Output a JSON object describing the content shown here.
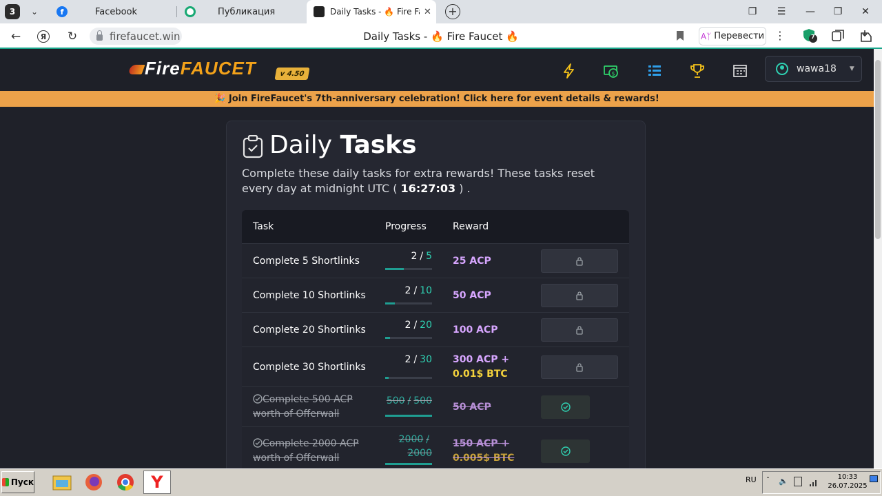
{
  "browser": {
    "tab_count": "3",
    "tabs": [
      {
        "title": "Facebook",
        "icon": "facebook-icon",
        "color": "#1877f2"
      },
      {
        "title": "Публикация",
        "icon": "publication-icon",
        "color": "#19a974"
      },
      {
        "title": "Daily Tasks - 🔥 Fire Fau",
        "icon": "firefaucet-icon",
        "color": "#222"
      }
    ],
    "url": "firefaucet.win",
    "page_title": "Daily Tasks - 🔥 Fire Faucet 🔥",
    "translate_label": "Перевести",
    "shield_badge": "7"
  },
  "site": {
    "logo_fire": "Fire",
    "logo_faucet": "FAUCET",
    "version": "v 4.50",
    "username": "wawa18",
    "nav_icons": [
      "bolt-icon",
      "money-icon",
      "tasks-icon",
      "trophy-icon",
      "calendar-icon"
    ],
    "accent": "#2fd1b2",
    "banner": "🎉 Join FireFaucet's 7th-anniversary celebration! Click here for event details & rewards!"
  },
  "page": {
    "title_light": "Daily",
    "title_bold": "Tasks",
    "subtitle": "Complete these daily tasks for extra rewards! These tasks reset every day at midnight UTC (",
    "reset_time": "16:27:03",
    "subtitle_end": ") ."
  },
  "table": {
    "headers": [
      "Task",
      "Progress",
      "Reward"
    ],
    "rows": [
      {
        "task": "Complete 5 Shortlinks",
        "current": "2",
        "goal": "5",
        "progress": 0.4,
        "reward": "25 ACP",
        "reward_btc": "",
        "status": "locked"
      },
      {
        "task": "Complete 10 Shortlinks",
        "current": "2",
        "goal": "10",
        "progress": 0.2,
        "reward": "50 ACP",
        "reward_btc": "",
        "status": "locked"
      },
      {
        "task": "Complete 20 Shortlinks",
        "current": "2",
        "goal": "20",
        "progress": 0.1,
        "reward": "100 ACP",
        "reward_btc": "",
        "status": "locked"
      },
      {
        "task": "Complete 30 Shortlinks",
        "current": "2",
        "goal": "30",
        "progress": 0.067,
        "reward": "300 ACP +",
        "reward_btc": "0.01$ BTC",
        "status": "locked"
      },
      {
        "task": "Complete 500 ACP worth of Offerwall",
        "current": "500",
        "goal": "500",
        "progress": 1.0,
        "reward": "50 ACP",
        "reward_btc": "",
        "status": "done"
      },
      {
        "task": "Complete 2000 ACP worth of Offerwall",
        "current": "2000",
        "goal": "2000",
        "progress": 1.0,
        "reward": "150 ACP +",
        "reward_btc": "0.005$ BTC",
        "status": "done"
      }
    ]
  },
  "taskbar": {
    "start_label": "Пуск",
    "language": "RU",
    "time": "10:33",
    "date": "26.07.2025"
  }
}
